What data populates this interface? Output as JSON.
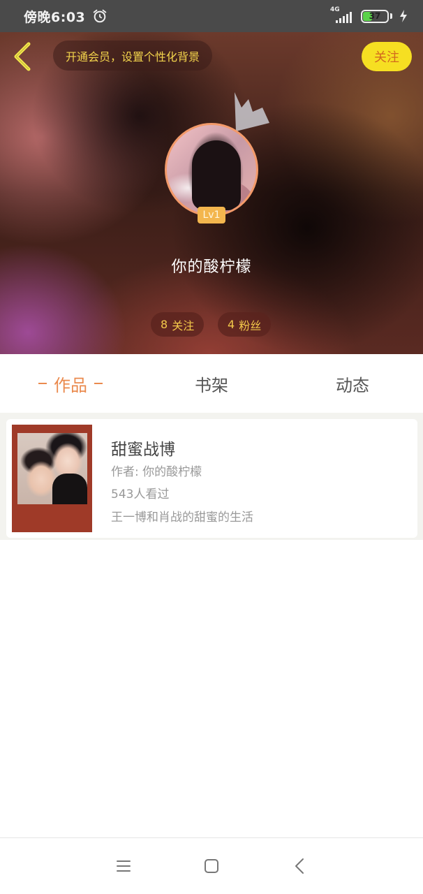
{
  "status_bar": {
    "time": "傍晚6:03",
    "network": "4G",
    "battery": "37",
    "battery_level": 0.37,
    "icons": [
      "alarm-icon",
      "signal-icon",
      "battery-icon",
      "charging-bolt-icon"
    ]
  },
  "header": {
    "back_icon": "chevron-left-icon",
    "vip_banner": "开通会员，设置个性化背景",
    "follow_label": "关注"
  },
  "profile": {
    "crown_icon": "crown-icon",
    "level": "Lv1",
    "username": "你的酸柠檬",
    "following_count": "8",
    "following_label": "关注",
    "fans_count": "4",
    "fans_label": "粉丝"
  },
  "tabs": [
    {
      "label": "作品",
      "active": true
    },
    {
      "label": "书架",
      "active": false
    },
    {
      "label": "动态",
      "active": false
    }
  ],
  "works": [
    {
      "title": "甜蜜战博",
      "author": "作者: 你的酸柠檬",
      "views": "543人看过",
      "description": "王一博和肖战的甜蜜的生活"
    }
  ],
  "navbar": {
    "icons": [
      "menu-icon",
      "home-square-icon",
      "back-triangle-icon"
    ]
  },
  "colors": {
    "accent": "#ea8a4e",
    "follow_button": "#f6df22",
    "gold_text": "#f3c94a"
  }
}
